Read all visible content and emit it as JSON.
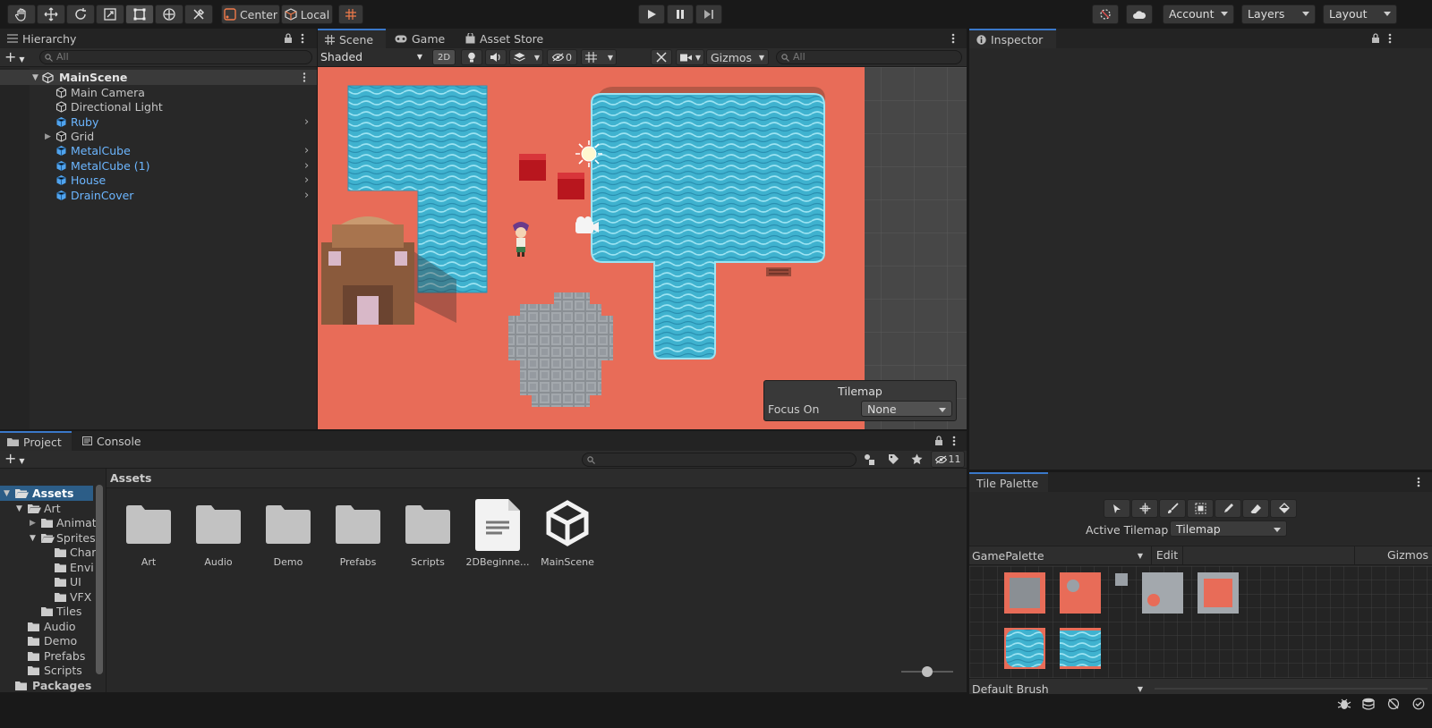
{
  "toolbar": {
    "pivot_label": "Center",
    "space_label": "Local",
    "account_label": "Account",
    "layers_label": "Layers",
    "layout_label": "Layout"
  },
  "hierarchy": {
    "tab_label": "Hierarchy",
    "search_placeholder": "All",
    "scene_name": "MainScene",
    "items": [
      {
        "label": "Main Camera"
      },
      {
        "label": "Directional Light"
      },
      {
        "label": "Ruby"
      },
      {
        "label": "Grid"
      },
      {
        "label": "MetalCube"
      },
      {
        "label": "MetalCube (1)"
      },
      {
        "label": "House"
      },
      {
        "label": "DrainCover"
      }
    ]
  },
  "scene_view": {
    "tabs": [
      {
        "label": "Scene"
      },
      {
        "label": "Game"
      },
      {
        "label": "Asset Store"
      }
    ],
    "shading_mode": "Shaded",
    "mode_2d": "2D",
    "hidden_count": "0",
    "gizmos_label": "Gizmos",
    "search_placeholder": "All",
    "overlay": {
      "title": "Tilemap",
      "focus_label": "Focus On",
      "focus_value": "None"
    }
  },
  "inspector": {
    "tab_label": "Inspector"
  },
  "project": {
    "tabs": [
      {
        "label": "Project"
      },
      {
        "label": "Console"
      }
    ],
    "hidden_count": "11",
    "breadcrumb": "Assets",
    "tree": [
      {
        "label": "Assets"
      },
      {
        "label": "Art"
      },
      {
        "label": "Animat"
      },
      {
        "label": "Sprites"
      },
      {
        "label": "Char"
      },
      {
        "label": "Envi"
      },
      {
        "label": "UI"
      },
      {
        "label": "VFX"
      },
      {
        "label": "Tiles"
      },
      {
        "label": "Audio"
      },
      {
        "label": "Demo"
      },
      {
        "label": "Prefabs"
      },
      {
        "label": "Scripts"
      },
      {
        "label": "Packages"
      }
    ],
    "assets": [
      {
        "label": "Art"
      },
      {
        "label": "Audio"
      },
      {
        "label": "Demo"
      },
      {
        "label": "Prefabs"
      },
      {
        "label": "Scripts"
      },
      {
        "label": "2DBeginne..."
      },
      {
        "label": "MainScene"
      }
    ],
    "zoom_level": 0.5
  },
  "tile_palette": {
    "tab_label": "Tile Palette",
    "active_tilemap_label": "Active Tilemap",
    "active_tilemap_value": "Tilemap",
    "palette_name": "GamePalette",
    "edit_label": "Edit",
    "gizmos_label": "Gizmos",
    "brush_label": "Default Brush"
  },
  "colors": {
    "ground": "#e86c58",
    "water": "#3fb2cf",
    "accent": "#3a78c9",
    "link_blue": "#6cb6ff"
  }
}
